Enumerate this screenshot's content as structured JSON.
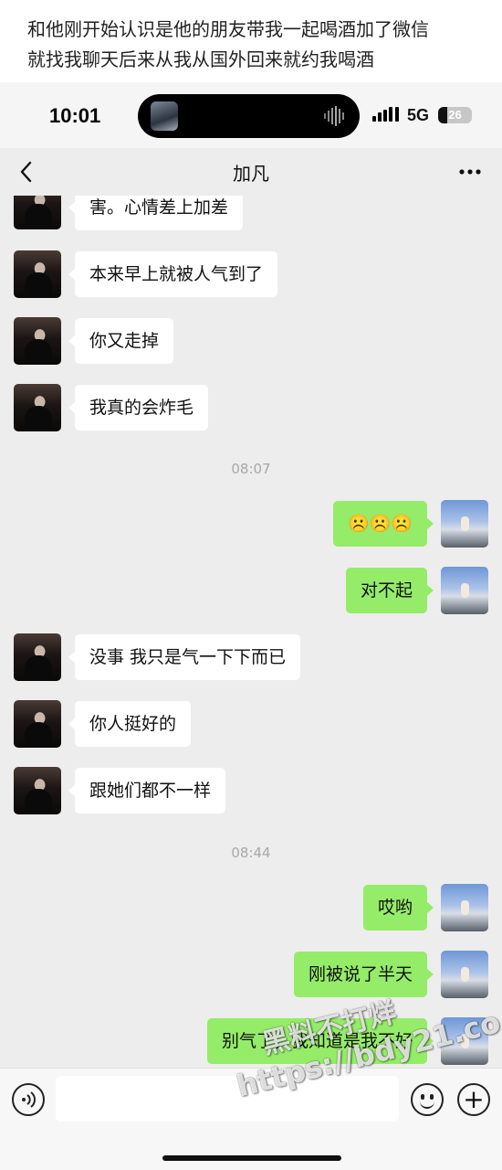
{
  "caption": {
    "line1": "和他刚开始认识是他的朋友带我一起喝酒加了微信",
    "line2": "就找我聊天后来从我从国外回来就约我喝酒"
  },
  "status_bar": {
    "time": "10:01",
    "network": "5G",
    "battery": "26",
    "battery_level": 0.26,
    "icons": [
      "album-thumbnail-icon",
      "audio-waveform-icon",
      "signal-icon"
    ]
  },
  "nav": {
    "title": "加凡",
    "back_icon": "chevron-left-icon",
    "more_icon": "more-dots-icon"
  },
  "messages": [
    {
      "side": "other",
      "text": "害。心情差上加差"
    },
    {
      "side": "other",
      "text": "本来早上就被人气到了"
    },
    {
      "side": "other",
      "text": "你又走掉"
    },
    {
      "side": "other",
      "text": "我真的会炸毛"
    },
    {
      "type": "time",
      "text": "08:07"
    },
    {
      "side": "self",
      "text": "☹️☹️☹️"
    },
    {
      "side": "self",
      "text": "对不起"
    },
    {
      "side": "other",
      "text": "没事 我只是气一下下而已"
    },
    {
      "side": "other",
      "text": "你人挺好的"
    },
    {
      "side": "other",
      "text": "跟她们都不一样"
    },
    {
      "type": "time",
      "text": "08:44"
    },
    {
      "side": "self",
      "text": "哎哟"
    },
    {
      "side": "self",
      "text": "刚被说了半天"
    },
    {
      "side": "self",
      "text": "别气了，我知道是我不好"
    }
  ],
  "input_bar": {
    "voice_icon": "voice-icon",
    "emoji_icon": "emoji-icon",
    "plus_icon": "plus-icon"
  },
  "watermark": {
    "line1": "黑料不打烊",
    "line2": "https://bdy21.co"
  }
}
